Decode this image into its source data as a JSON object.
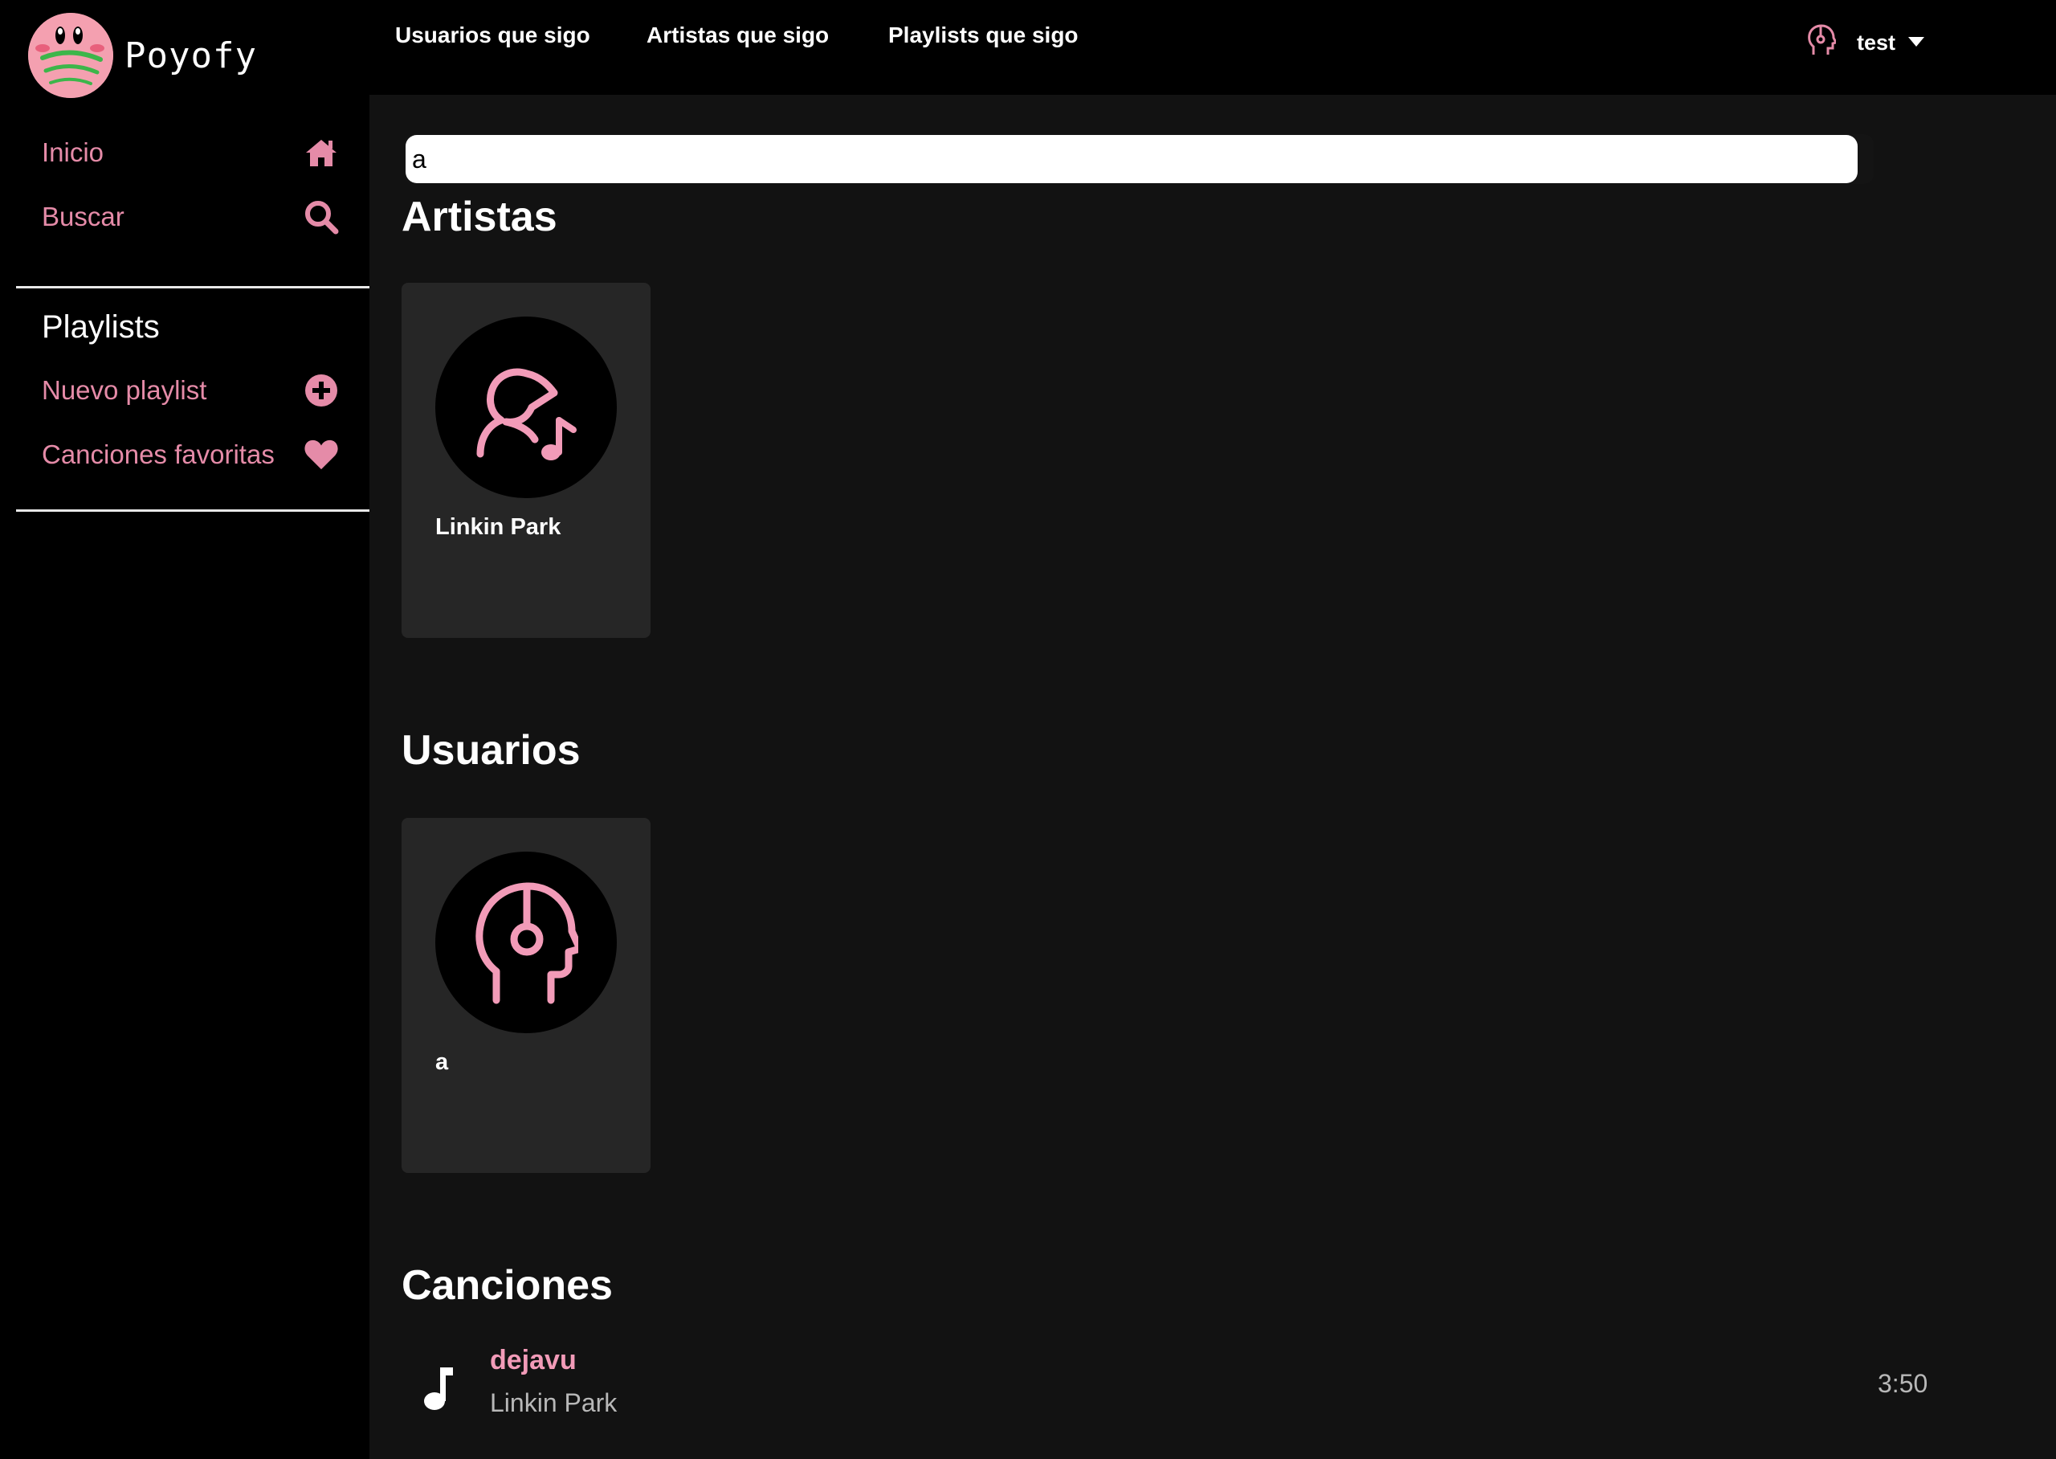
{
  "app": {
    "logo_text": "Poyofy"
  },
  "colors": {
    "accent": "#e58ba8",
    "background": "#000000",
    "main_bg": "#121212",
    "card_bg": "#262626"
  },
  "topnav": {
    "links": [
      "Usuarios que sigo",
      "Artistas que sigo",
      "Playlists que sigo"
    ],
    "user": {
      "icon": "user-headphones-icon",
      "name": "test",
      "caret": "caret-down-icon"
    }
  },
  "sidebar": {
    "items": [
      {
        "label": "Inicio",
        "icon": "home-icon"
      },
      {
        "label": "Buscar",
        "icon": "search-icon"
      }
    ],
    "playlists_title": "Playlists",
    "playlist_items": [
      {
        "label": "Nuevo playlist",
        "icon": "plus-circle-icon"
      },
      {
        "label": "Canciones favoritas",
        "icon": "heart-icon"
      }
    ]
  },
  "search": {
    "value": "a"
  },
  "sections": {
    "artists_title": "Artistas",
    "users_title": "Usuarios",
    "songs_title": "Canciones"
  },
  "artists": [
    {
      "name": "Linkin Park",
      "icon": "artist-music-icon"
    }
  ],
  "users": [
    {
      "name": "a",
      "icon": "user-headphones-icon"
    }
  ],
  "songs": [
    {
      "title": "dejavu",
      "artist": "Linkin Park",
      "duration": "3:50",
      "icon": "music-note-icon"
    }
  ]
}
